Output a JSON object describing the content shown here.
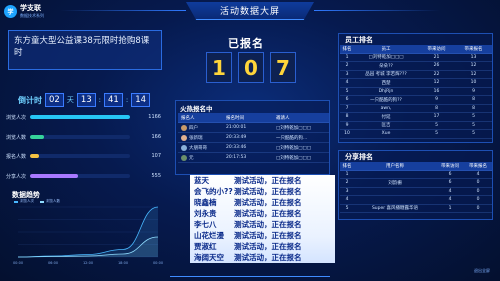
{
  "brand": {
    "name": "学支联",
    "subtitle": "数据技术系列"
  },
  "title": "活动数据大屏",
  "course": {
    "title": "东方童大型公益课38元限时抢购8课时"
  },
  "countdown": {
    "label": "倒计时",
    "days": "02",
    "days_unit": "天",
    "hours": "13",
    "minutes": "41",
    "seconds": "14"
  },
  "stats": [
    {
      "label": "浏览人次",
      "value": "1166",
      "fraction": 1.0,
      "color": "#26c6f5"
    },
    {
      "label": "浏览人数",
      "value": "166",
      "fraction": 0.14,
      "color": "#35d39a"
    },
    {
      "label": "报名人数",
      "value": "107",
      "fraction": 0.09,
      "color": "#f5c242"
    },
    {
      "label": "分享人次",
      "value": "555",
      "fraction": 0.48,
      "color": "#a879ff"
    }
  ],
  "trend": {
    "title": "数据趋势",
    "legend": [
      "浏览人次",
      "浏览人数"
    ],
    "x_labels": [
      "00:00",
      "06:00",
      "12:00",
      "18:00",
      "00:00"
    ],
    "chart_data": {
      "type": "line",
      "x": [
        "00:00",
        "06:00",
        "12:00",
        "18:00",
        "00:00"
      ],
      "series": [
        {
          "name": "浏览人次",
          "values": [
            0,
            2,
            5,
            15,
            100
          ]
        },
        {
          "name": "浏览人数",
          "values": [
            0,
            1,
            2,
            6,
            40
          ]
        }
      ]
    }
  },
  "registered": {
    "label": "已报名",
    "digits": [
      "1",
      "0",
      "7"
    ]
  },
  "hot": {
    "title": "火热报名中",
    "headers": [
      "报名人",
      "报名时间",
      "邀请人"
    ],
    "rows": [
      {
        "name": "四户",
        "time": "21:00:01",
        "inviter": "□刘特乾加□□□"
      },
      {
        "name": "张新瑞",
        "time": "20:33:49",
        "inviter": "一只酷酷的狗..."
      },
      {
        "name": "大朋哥哥",
        "time": "20:33:46",
        "inviter": "□刘特乾加□□□"
      },
      {
        "name": "元",
        "time": "20:17:53",
        "inviter": "□刘特乾加□□□"
      }
    ]
  },
  "ticker": [
    {
      "name": "蓝天",
      "msg": "测试活动，正在报名"
    },
    {
      "name": "会飞的小??",
      "msg": "测试活动，正在报名"
    },
    {
      "name": "晓鑫楠",
      "msg": "测试活动，正在报名"
    },
    {
      "name": "刘永贵",
      "msg": "测试活动，正在报名"
    },
    {
      "name": "李七八",
      "msg": "测试活动，正在报名"
    },
    {
      "name": "山花烂漫",
      "msg": "测试活动，正在报名"
    },
    {
      "name": "贾淑红",
      "msg": "测试活动，正在报名"
    },
    {
      "name": "海阔天空",
      "msg": "测试活动，正在报名"
    }
  ],
  "staff": {
    "title": "员工排名",
    "headers": [
      "排名",
      "员工",
      "带来访问",
      "带来报名"
    ],
    "rows": [
      [
        "1",
        "□刘特乾加□□□",
        "21",
        "13"
      ],
      [
        "2",
        "朵朵??",
        "26",
        "12"
      ],
      [
        "3",
        "品园 考城 李若辉???",
        "22",
        "12"
      ],
      [
        "4",
        "西楚",
        "12",
        "10"
      ],
      [
        "5",
        "DhjRjn",
        "16",
        "9"
      ],
      [
        "6",
        "一只酷酷的狗??",
        "9",
        "8"
      ],
      [
        "7",
        "awn,",
        "8",
        "8"
      ],
      [
        "8",
        "付延",
        "17",
        "5"
      ],
      [
        "9",
        "匡吉",
        "5",
        "5"
      ],
      [
        "10",
        "Xue",
        "5",
        "5"
      ]
    ]
  },
  "share": {
    "title": "分享排名",
    "headers": [
      "排名",
      "用户名称",
      "带来访问",
      "带来报名"
    ],
    "rows": [
      [
        "1",
        "",
        "6",
        "4"
      ],
      [
        "2",
        "刘韵栅",
        "6",
        "0"
      ],
      [
        "3",
        "",
        "4",
        "0"
      ],
      [
        "4",
        "",
        "4",
        "0"
      ],
      [
        "5",
        "Super 喜风播糖露华语",
        "1",
        "0"
      ]
    ]
  },
  "footer": "退出全屏"
}
